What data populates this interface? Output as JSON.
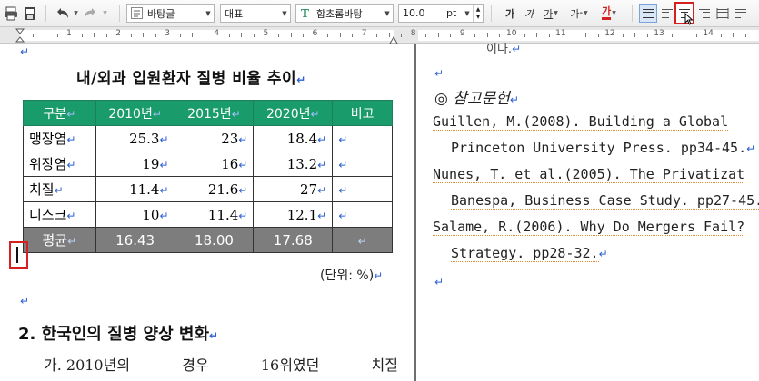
{
  "toolbar": {
    "style_value": "바탕글",
    "language_value": "대표",
    "font_value": "함초롬바탕",
    "font_size_value": "10.0",
    "font_size_unit": "pt",
    "bold_label": "가",
    "italic_label": "가",
    "underline_label": "가",
    "strike_label": "가",
    "color_label": "가",
    "accent_red": "#d42020"
  },
  "ruler": {
    "numbers": [
      "1",
      "2",
      "3",
      "4",
      "5",
      "6",
      "7",
      "8",
      "9",
      "10",
      "11",
      "12",
      "13",
      "14",
      "15"
    ]
  },
  "left_page": {
    "title": "내/외과 입원환자 질병 비율 추이",
    "table": {
      "headers": [
        "구분",
        "2010년",
        "2015년",
        "2020년",
        "비고"
      ],
      "rows": [
        {
          "label": "맹장염",
          "v2010": "25.3",
          "v2015": "23",
          "v2020": "18.4"
        },
        {
          "label": "위장염",
          "v2010": "19",
          "v2015": "16",
          "v2020": "13.2"
        },
        {
          "label": "치질",
          "v2010": "11.4",
          "v2015": "21.6",
          "v2020": "27"
        },
        {
          "label": "디스크",
          "v2010": "10",
          "v2015": "11.4",
          "v2020": "12.1"
        }
      ],
      "average": {
        "label": "평균",
        "v2010": "16.43",
        "v2015": "18.00",
        "v2020": "17.68"
      },
      "header_color": "#199b6c",
      "average_color": "#7d7d7d"
    },
    "unit_note": "(단위: %)",
    "heading": "2. 한국인의 질병 양상 변화",
    "body_words": [
      "가. 2010년의",
      "경우",
      "16위였던",
      "치질"
    ]
  },
  "right_page": {
    "top_fragment": "이다.",
    "ref_title": "◎ 참고문헌",
    "refs": [
      "Guillen, M.(2008). Building a Global",
      "Princeton University Press. pp34-45.",
      "Nunes, T. et al.(2005). The Privatizat",
      "Banespa, Business Case Study. pp27-45.",
      "Salame, R.(2006). Why Do Mergers Fail?",
      "Strategy. pp28-32."
    ]
  },
  "paragraph_mark": "↵"
}
